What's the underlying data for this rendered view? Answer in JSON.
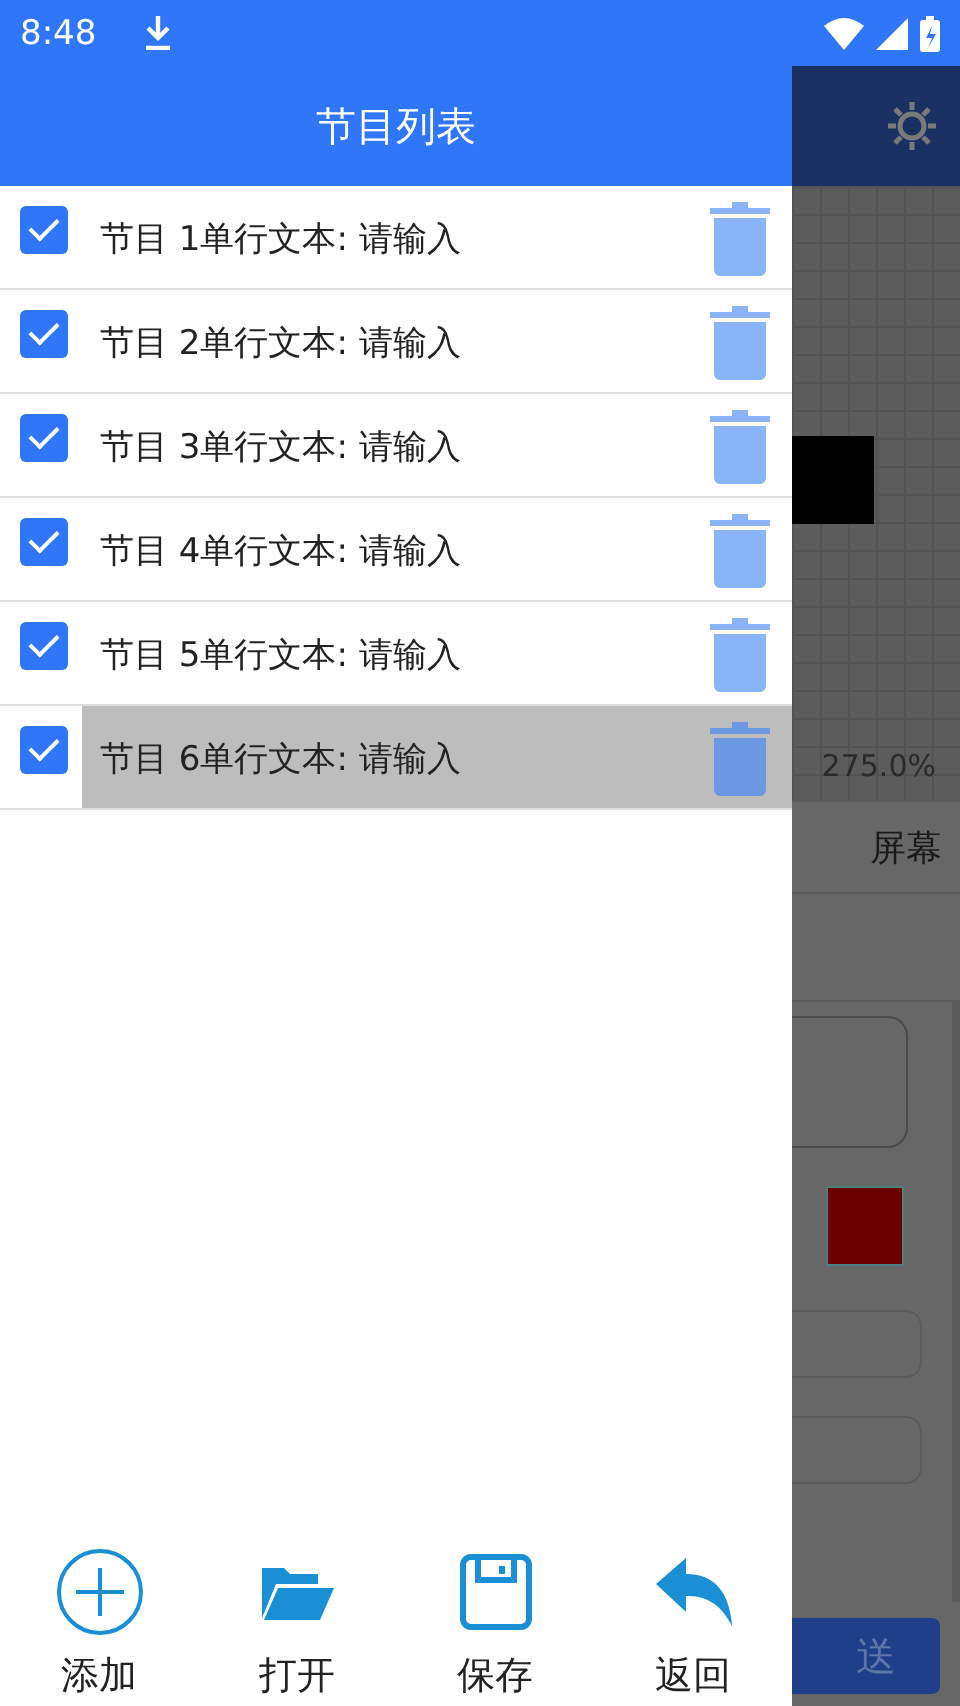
{
  "status_bar": {
    "time": "8:48"
  },
  "drawer": {
    "title": "节目列表",
    "programs": [
      {
        "label": "节目 1单行文本: 请输入",
        "checked": true,
        "selected": false
      },
      {
        "label": "节目 2单行文本: 请输入",
        "checked": true,
        "selected": false
      },
      {
        "label": "节目 3单行文本: 请输入",
        "checked": true,
        "selected": false
      },
      {
        "label": "节目 4单行文本: 请输入",
        "checked": true,
        "selected": false
      },
      {
        "label": "节目 5单行文本: 请输入",
        "checked": true,
        "selected": false
      },
      {
        "label": "节目 6单行文本: 请输入",
        "checked": true,
        "selected": true
      }
    ],
    "actions": [
      {
        "kind": "add",
        "label": "添加"
      },
      {
        "kind": "open",
        "label": "打开"
      },
      {
        "kind": "save",
        "label": "保存"
      },
      {
        "kind": "back",
        "label": "返回"
      }
    ]
  },
  "background": {
    "zoom": "275.0%",
    "tab_label": "屏幕",
    "send_button": "送"
  }
}
